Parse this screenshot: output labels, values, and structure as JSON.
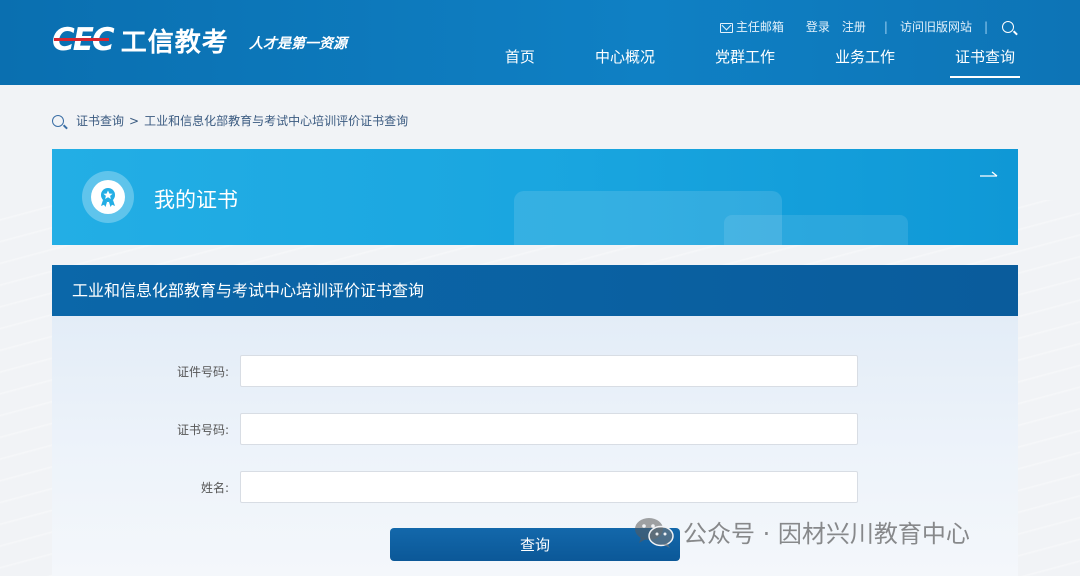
{
  "header": {
    "logo_mark": "CEC",
    "logo_text": "工信教考",
    "slogan": "人才是第一资源",
    "top_links": {
      "mailbox": "主任邮箱",
      "login": "登录",
      "register": "注册",
      "separator": "|",
      "old_site": "访问旧版网站"
    },
    "nav": [
      {
        "label": "首页"
      },
      {
        "label": "中心概况"
      },
      {
        "label": "党群工作"
      },
      {
        "label": "业务工作"
      },
      {
        "label": "证书查询",
        "active": true
      }
    ]
  },
  "breadcrumb": {
    "root": "证书查询",
    "separator": ">",
    "current": "工业和信息化部教育与考试中心培训评价证书查询"
  },
  "banner": {
    "title": "我的证书"
  },
  "form": {
    "heading": "工业和信息化部教育与考试中心培训评价证书查询",
    "fields": [
      {
        "label": "证件号码:",
        "value": "",
        "placeholder": ""
      },
      {
        "label": "证书号码:",
        "value": "",
        "placeholder": ""
      },
      {
        "label": "姓名:",
        "value": "",
        "placeholder": ""
      }
    ],
    "submit_label": "查询"
  },
  "watermark": {
    "text": "公众号 · 因材兴川教育中心"
  },
  "colors": {
    "header_blue": "#0f80c4",
    "banner_blue": "#1fa9e2",
    "panel_head_blue": "#0b67a9",
    "button_blue": "#0f60a2"
  }
}
